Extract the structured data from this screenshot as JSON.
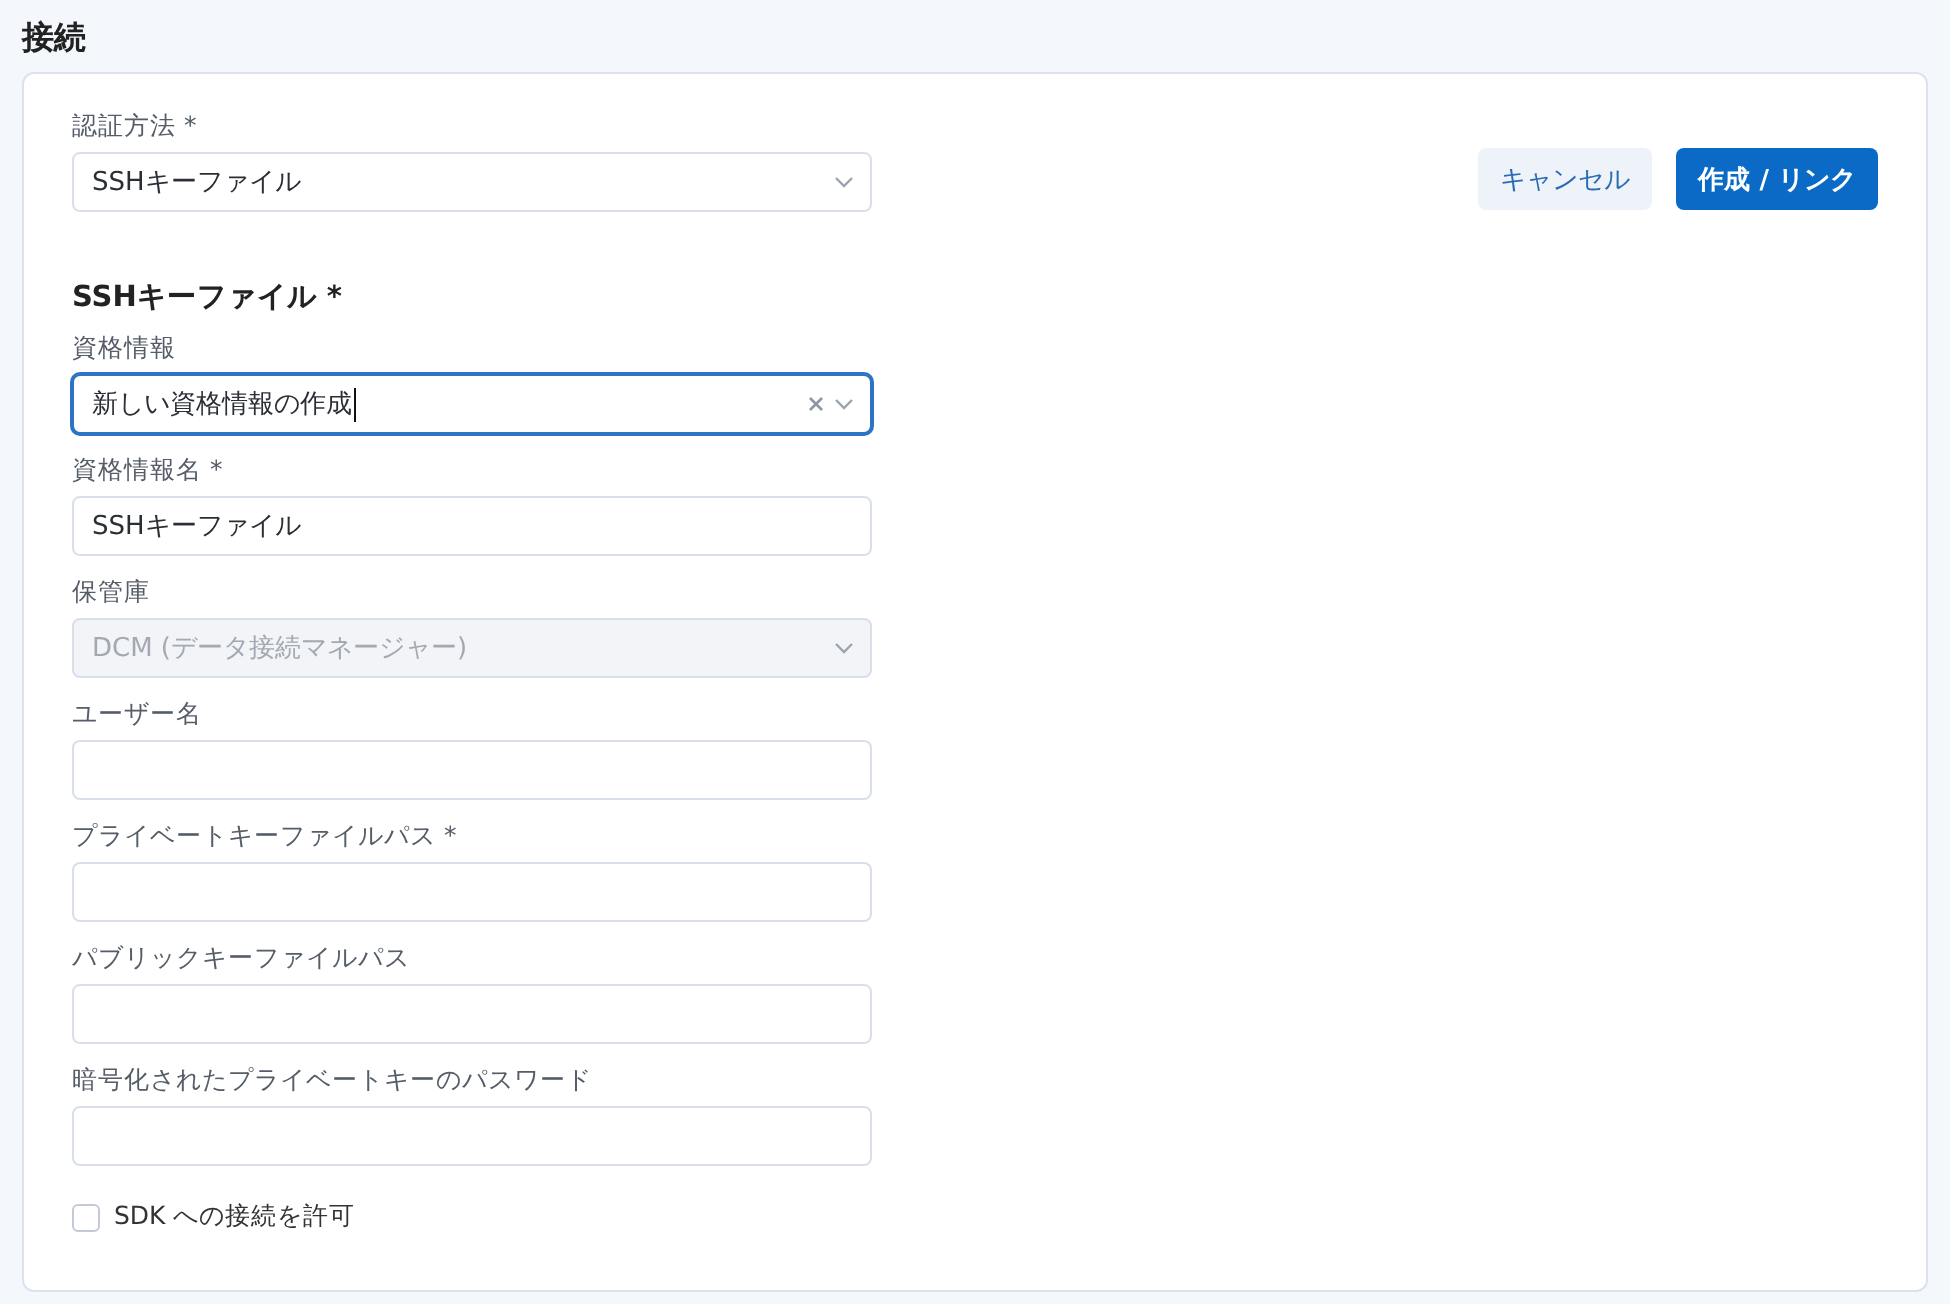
{
  "heading": "接続",
  "auth_method": {
    "label": "認証方法 *",
    "kind": "select",
    "value": "SSHキーファイル",
    "focused": false,
    "clearable": false,
    "disabled": false
  },
  "buttons": [
    {
      "label": "キャンセル",
      "kind": "secondary"
    },
    {
      "label": "作成 / リンク",
      "kind": "primary"
    }
  ],
  "section_title": "SSHキーファイル *",
  "fields": [
    {
      "label": "資格情報",
      "kind": "select",
      "value": "新しい資格情報の作成",
      "focused": true,
      "clearable": true,
      "disabled": false
    },
    {
      "label": "資格情報名 *",
      "kind": "text",
      "value": "SSHキーファイル",
      "focused": false,
      "disabled": false
    },
    {
      "label": "保管庫",
      "kind": "select",
      "value": "DCM (データ接続マネージャー)",
      "focused": false,
      "clearable": false,
      "disabled": true
    },
    {
      "label": "ユーザー名",
      "kind": "text",
      "focused": false,
      "disabled": false
    },
    {
      "label": "プライベートキーファイルパス *",
      "kind": "text",
      "focused": false,
      "disabled": false
    },
    {
      "label": "パブリックキーファイルパス",
      "kind": "text",
      "focused": false,
      "disabled": false
    },
    {
      "label": "暗号化されたプライベートキーのパスワード",
      "kind": "text",
      "focused": false,
      "disabled": false
    }
  ],
  "checkbox": {
    "label": "SDK への接続を許可",
    "checked": false
  }
}
